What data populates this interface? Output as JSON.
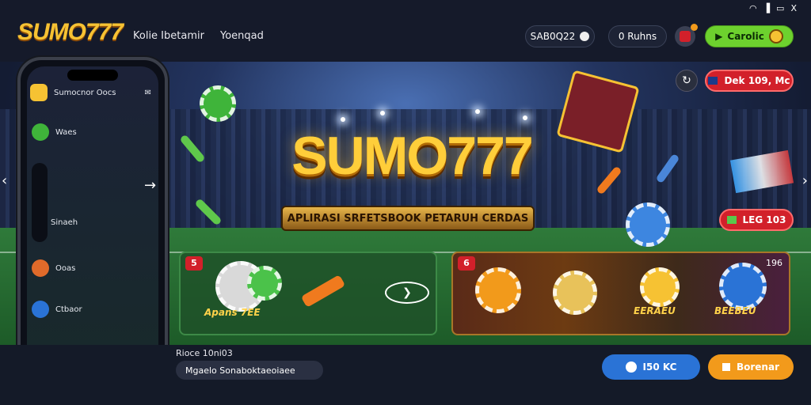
{
  "app": {
    "logo": "SUMO777"
  },
  "nav": {
    "item1": "Kolie Ibetamir",
    "item2": "Yoenqad"
  },
  "header": {
    "balance_code": "SAB0Q22",
    "pill2": "0 Ruhns",
    "cta": "Carolic"
  },
  "statusbar": {
    "close": "X"
  },
  "hero": {
    "title": "SUMO777",
    "tagline": "APLIRASI SRFETSBOOK PETARUH CERDAS",
    "top_button": "Dek 109, Mc",
    "side_button": "LEG 103"
  },
  "promo": {
    "left_badge": "5",
    "left_label": "Apans 7EE",
    "right_badge": "6",
    "right_label_1": "EERAEU",
    "right_label_2": "BEEBEU",
    "right_count": "196"
  },
  "phone": {
    "header": "Sumocnor Oocs",
    "items": [
      "Waes",
      "Sinaeh",
      "Ooas",
      "Ctbaor"
    ]
  },
  "bottom": {
    "heading": "Rioce 10ni03",
    "search_value": "Mgaelo Sonaboktaeoiaee",
    "btn1": "I50 KC",
    "btn2": "Borenar"
  },
  "colors": {
    "accent": "#f6c233",
    "green": "#6dd12e",
    "red": "#d2202a",
    "orange": "#f29a1b",
    "blue": "#2a73d6"
  }
}
